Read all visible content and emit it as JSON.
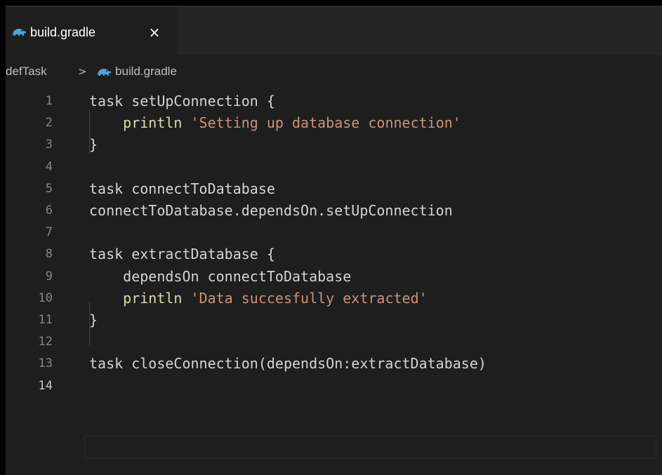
{
  "tab": {
    "icon": "gradle-elephant-icon",
    "label": "build.gradle",
    "close": "×"
  },
  "breadcrumb": {
    "folder": "defTask",
    "separator": ">",
    "icon": "gradle-elephant-icon",
    "file": "build.gradle"
  },
  "colors": {
    "background": "#1e1e1e",
    "keyword": "#dcdcaa",
    "string": "#ce9178",
    "text": "#d4d4d4",
    "line_number": "#858585",
    "gradle_icon": "#4aa3df"
  },
  "code": {
    "lines": [
      {
        "n": "1",
        "text": "task setUpConnection {"
      },
      {
        "n": "2",
        "indent": "    ",
        "kw": "println",
        "str": "'Setting up database connection'"
      },
      {
        "n": "3",
        "text": "}"
      },
      {
        "n": "4",
        "text": ""
      },
      {
        "n": "5",
        "text": "task connectToDatabase"
      },
      {
        "n": "6",
        "text": "connectToDatabase.dependsOn.setUpConnection"
      },
      {
        "n": "7",
        "text": ""
      },
      {
        "n": "8",
        "text": "task extractDatabase {"
      },
      {
        "n": "9",
        "text": "    dependsOn connectToDatabase"
      },
      {
        "n": "10",
        "indent": "    ",
        "kw": "println",
        "str": "'Data succesfully extracted'"
      },
      {
        "n": "11",
        "text": "}"
      },
      {
        "n": "12",
        "text": ""
      },
      {
        "n": "13",
        "text": "task closeConnection(dependsOn:extractDatabase)"
      },
      {
        "n": "14",
        "text": ""
      }
    ]
  }
}
